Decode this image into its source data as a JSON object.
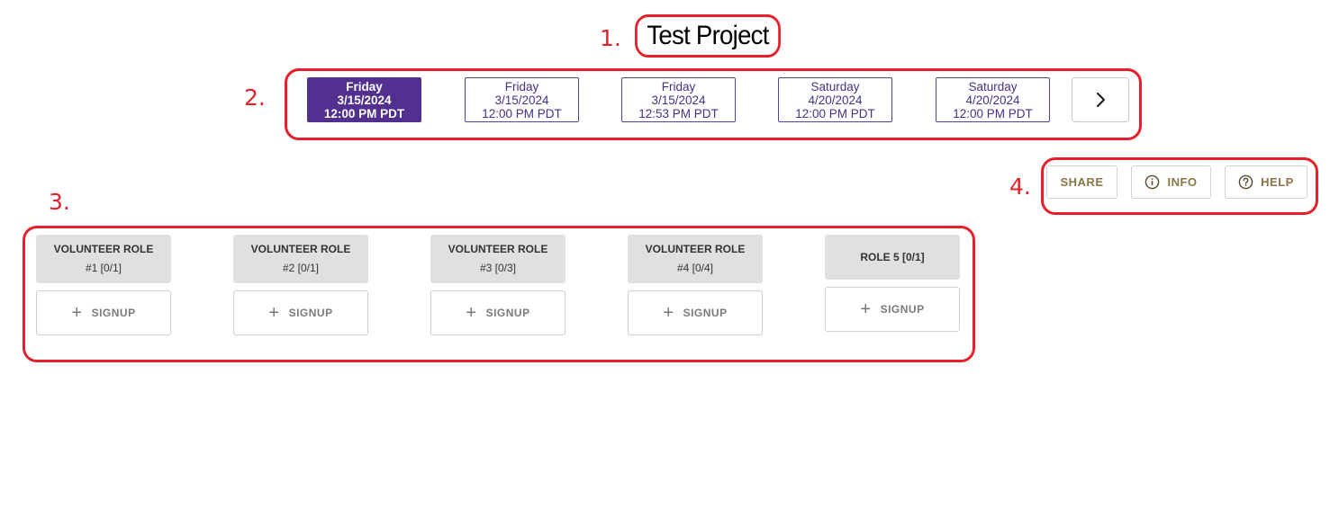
{
  "annotations": [
    "1.",
    "2.",
    "3.",
    "4."
  ],
  "project": {
    "title": "Test Project"
  },
  "dates": [
    {
      "day": "Friday",
      "date": "3/15/2024",
      "time": "12:00 PM PDT",
      "active": true
    },
    {
      "day": "Friday",
      "date": "3/15/2024",
      "time": "12:00 PM PDT",
      "active": false
    },
    {
      "day": "Friday",
      "date": "3/15/2024",
      "time": "12:53 PM PDT",
      "active": false
    },
    {
      "day": "Saturday",
      "date": "4/20/2024",
      "time": "12:00 PM PDT",
      "active": false
    },
    {
      "day": "Saturday",
      "date": "4/20/2024",
      "time": "12:00 PM PDT",
      "active": false
    }
  ],
  "next_icon": "chevron-right-icon",
  "actions": {
    "share": "SHARE",
    "info": "INFO",
    "help": "HELP"
  },
  "roles": [
    {
      "line1": "VOLUNTEER ROLE",
      "line2": "#1 [0/1]",
      "signup": "SIGNUP"
    },
    {
      "line1": "VOLUNTEER ROLE",
      "line2": "#2 [0/1]",
      "signup": "SIGNUP"
    },
    {
      "line1": "VOLUNTEER ROLE",
      "line2": "#3 [0/3]",
      "signup": "SIGNUP"
    },
    {
      "line1": "VOLUNTEER ROLE",
      "line2": "#4 [0/4]",
      "signup": "SIGNUP"
    },
    {
      "line1": "ROLE 5 [0/1]",
      "line2": "",
      "signup": "SIGNUP"
    }
  ],
  "colors": {
    "annotation": "#e5202a",
    "primary": "#52308f",
    "action_text": "#8a7648",
    "role_header_bg": "#e0e0e0"
  }
}
